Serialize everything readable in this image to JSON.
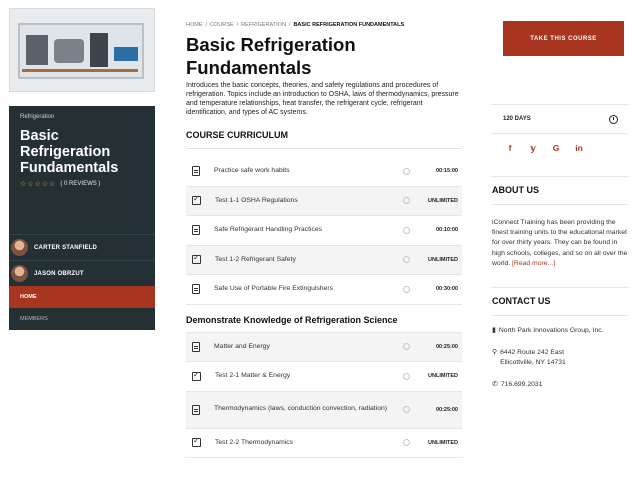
{
  "sidebar": {
    "category": "Refrigeration",
    "title": "Basic Refrigeration Fundamentals",
    "stars": "☆☆☆☆☆",
    "reviews": "( 0 REVIEWS )",
    "instructors": [
      "CARTER STANFIELD",
      "JASON OBRZUT"
    ],
    "nav": {
      "home": "HOME",
      "members": "MEMBERS"
    }
  },
  "breadcrumb": {
    "items": [
      "HOME",
      "COURSE",
      "REFRIGERATION"
    ],
    "separator": "/",
    "current": "BASIC REFRIGERATION FUNDAMENTALS"
  },
  "main": {
    "title": "Basic Refrigeration Fundamentals",
    "description": "Introduces the basic concepts, theories, and safety regulations and procedures of refrigeration. Topics include an introduction to OSHA, laws of thermodynamics, pressure and temperature relationships, heat transfer, the refrigerant cycle, refrigerant identification, and types of AC systems.",
    "curriculum_heading": "COURSE CURRICULUM",
    "section1": [
      {
        "label": "Practice safe work habits",
        "duration": "00:15:00",
        "type": "doc"
      },
      {
        "label": "Test 1-1 OSHA Regulations",
        "duration": "UNLIMITED",
        "type": "quiz"
      },
      {
        "label": "Safe Refrigerant Handling Practices",
        "duration": "00:10:00",
        "type": "doc"
      },
      {
        "label": "Test 1-2 Refrigerant Safety",
        "duration": "UNLIMITED",
        "type": "quiz"
      },
      {
        "label": "Safe Use of Portable Fire Extinguishers",
        "duration": "00:30:00",
        "type": "doc"
      }
    ],
    "section2_heading": "Demonstrate Knowledge of Refrigeration Science",
    "section2": [
      {
        "label": "Matter and Energy",
        "duration": "00:25:00",
        "type": "doc"
      },
      {
        "label": "Test 2-1 Matter & Energy",
        "duration": "UNLIMITED",
        "type": "quiz"
      },
      {
        "label": "Thermodynamics (laws, conduction convection, radiation)",
        "duration": "00:25:00",
        "type": "doc"
      },
      {
        "label": "Test 2-2 Thermodynamics",
        "duration": "UNLIMITED",
        "type": "quiz"
      }
    ]
  },
  "right": {
    "take_course": "TAKE THIS COURSE",
    "duration": "120 DAYS",
    "social": [
      "f",
      "𝕪",
      "G",
      "in"
    ],
    "about_heading": "ABOUT US",
    "about_text": "iConnect Training has been providing the finest training units to the educational market for over thirty years. They can be found in high schools, colleges, and so on all over the world.",
    "read_more": "[Read more...]",
    "contact_heading": "CONTACT US",
    "company": "North Park Innovations Group, Inc.",
    "address1": "6442 Route 242 East",
    "address2": "Ellicottville, NY 14731",
    "phone": "716.699.2031"
  }
}
